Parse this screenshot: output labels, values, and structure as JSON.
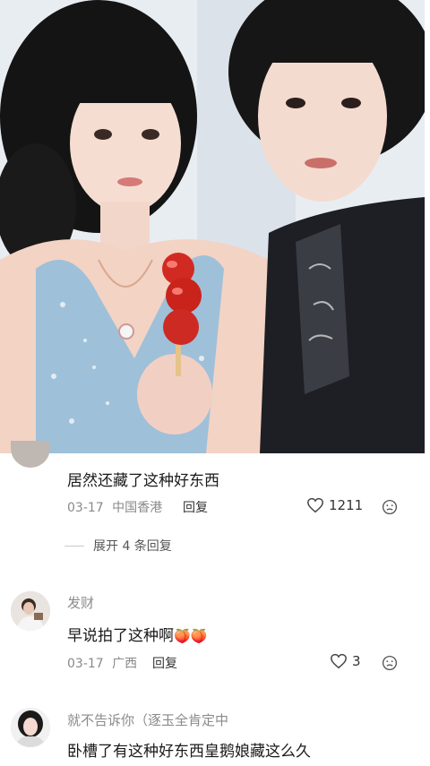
{
  "comments": [
    {
      "text": "居然还藏了这种好东西",
      "date": "03-17",
      "location": "中国香港",
      "reply_label": "回复",
      "likes": "1211"
    },
    {
      "username": "发财",
      "text": "早说拍了这种啊",
      "emoji": "🍑🍑",
      "date": "03-17",
      "location": "广西",
      "reply_label": "回复",
      "likes": "3"
    },
    {
      "username": "就不告诉你（逐玉全肯定中",
      "text": "卧槽了有这种好东西皇鹅娘藏这么久"
    }
  ],
  "expand_replies": "展开 4 条回复",
  "icons": {
    "like": "heart-outline-icon",
    "dislike": "frown-face-icon"
  }
}
